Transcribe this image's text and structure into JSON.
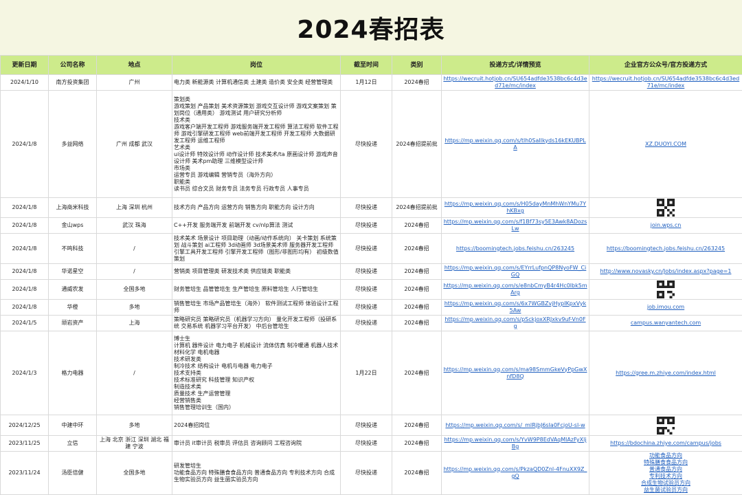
{
  "title": "2024春招表",
  "headers": [
    "更新日期",
    "公司名称",
    "地点",
    "岗位",
    "截至时间",
    "类别",
    "投递方式/详情预览",
    "企业官方公众号/官方投递方式"
  ],
  "rows": [
    {
      "date": "2024/1/10",
      "company": "南方投资集团",
      "location": "广州",
      "positions": "电力类 新能源类 计算机通信类 土建类 造价类 安全类 经营管理类",
      "deadline": "1月12日",
      "category": "2024春招",
      "apply": "https://wecruit.hotjob.cn/SU654adfde3538bc6c4d3ed71e/mc/index",
      "official": "https://wecruit.hotjob.cn/SU654adfde3538bc6c4d3ed71e/mc/index"
    },
    {
      "date": "2024/1/8",
      "company": "多益网络",
      "location": "广州 成都 武汉",
      "positions": "策划类\n游戏策划 产品策划 美术资源策划 游戏交互设计师 游戏文案策划 策划岗位（通用类） 游戏测试 用户研究分析师\n技术类\n游戏客户端开发工程师 游戏服务端开发工程师 算法工程师 软件工程师 游戏引擎研发工程师 web前端开发工程师 开发工程师 大数据研发工程师 运维工程师\n艺术类\nui设计师 特效设计师 动作设计师 技术美术/ta 原画设计师 游戏声音设计师 美术pm助理 三维模型设计师\n市场类\n运营专员 游戏编辑 营销专员（海外方向）\n职能类\n读书员 综合文员 财务专员 法务专员 行政专员 人事专员",
      "deadline": "尽快投递",
      "category": "2024春招提前批",
      "apply": "https://mp.weixin.qq.com/s/tlh0SaIlkyds16kEKUBPLA",
      "official": "XZ.DUOYI.COM"
    },
    {
      "date": "2024/1/8",
      "company": "上海商米科技",
      "location": "上海 深圳 杭州",
      "positions": "技术方向 产品方向 运营方向 销售方向 职能方向 设计方向",
      "deadline": "尽快投递",
      "category": "2024春招提前批",
      "apply": "https://mp.weixin.qq.com/s/H05dayMnMhWnYMu7YhKBxg",
      "official": ""
    },
    {
      "date": "2024/1/8",
      "company": "金山wps",
      "location": "武汉 珠海",
      "positions": "C++开发 服务端开发 前端开发 cv/nlp算法 测试",
      "deadline": "尽快投递",
      "category": "2024春招",
      "apply": "https://mp.weixin.qq.com/s/f1Bf73sy5E3Awk8ADozsLw",
      "official": "join.wps.cn"
    },
    {
      "date": "2024/1/8",
      "company": "不鸣科技",
      "location": "/",
      "positions": "技术美术 场景设计 项目助理（动画/动作系统向） 关卡策划 系统策划 战斗策划 ai工程师 3d动画师 3d场景美术师 服务器开发工程师 引擎工具开发工程师 引擎开发工程师（图形/非图形均有） 初级数值策划",
      "deadline": "尽快投递",
      "category": "2024春招",
      "apply": "https://boomingtech.jobs.feishu.cn/263245",
      "official": "https://boomingtech.jobs.feishu.cn/263245"
    },
    {
      "date": "2024/1/8",
      "company": "华诺星空",
      "location": "/",
      "positions": "营销类 项目管理类 研发技术类 供应链类 职能类",
      "deadline": "尽快投递",
      "category": "2024春招",
      "apply": "https://mp.weixin.qq.com/s/EYrrLufpnQP8NyoFW_CiGQ",
      "official": "http://www.novasky.cn/Jobs/index.aspx?page=1"
    },
    {
      "date": "2024/1/8",
      "company": "通威农发",
      "location": "全国多地",
      "positions": "财务管培生 品管管培生 生产管培生 原料管培生 人行管培生",
      "deadline": "尽快投递",
      "category": "2024春招",
      "apply": "https://mp.weixin.qq.com/s/e8nbCmyB4r4Hc0lbk5mArg",
      "official": ""
    },
    {
      "date": "2024/1/8",
      "company": "华橙",
      "location": "多地",
      "positions": "销售管培生 市场产品管培生（海外） 软件测试工程师 体验设计工程师",
      "deadline": "尽快投递",
      "category": "2024春招",
      "apply": "https://mp.weixin.qq.com/s/6x7WGBZvjHypIKpxVyk5Aw",
      "official": "job.imou.com"
    },
    {
      "date": "2024/1/5",
      "company": "顽岩资产",
      "location": "上海",
      "positions": "策略研究员 策略研究员（机器学习方向） 量化开发工程师（投研系统 交易系统 机器学习平台开发） 中后台管培生",
      "deadline": "尽快投递",
      "category": "2024春招",
      "apply": "https://mp.weixin.qq.com/s/pSckjoxXRJxkv9uf-Vn0Fg",
      "official": "campus.wanyantech.com"
    },
    {
      "date": "2024/1/3",
      "company": "格力电器",
      "location": "/",
      "positions": "博士生\n计算机 器件设计 电力电子 机械设计 流体仿真 制冷暖通 机器人技术 材料化学 电机电器\n技术研发类\n制冷技术 结构设计 电机与电器 电力电子\n技术支持类\n技术标准研究 科技管理 知识产权\n制造技术类\n质量技术 生产运营管理\n经营销售类\n销售管理培训生（国内）",
      "deadline": "1月22日",
      "category": "2024春招",
      "apply": "https://mp.weixin.qq.com/s/ma98SmmGkeVyPpGwXnfD8Q",
      "official": "https://gree.m.zhiye.com/index.html"
    },
    {
      "date": "2024/12/25",
      "company": "中建中环",
      "location": "多地",
      "positions": "2024春招岗位",
      "deadline": "尽快投递",
      "category": "2024春招",
      "apply": "https://mp.weixin.qq.com/s/_mlRjbJ6sIa0FcjoU-sl-w",
      "official": ""
    },
    {
      "date": "2023/11/25",
      "company": "立信",
      "location": "上海 北京 浙江 深圳 湖北 福建 宁波",
      "positions": "审计员 it审计员 税审员 评估员 咨询顾问 工程咨询院",
      "deadline": "尽快投递",
      "category": "2024春招",
      "apply": "https://mp.weixin.qq.com/s/YvW9P8EdVAqMlAzFyXljBg",
      "official": "https://bdochina.zhiye.com/campus/jobs"
    },
    {
      "date": "2023/11/24",
      "company": "汤臣倍健",
      "location": "全国多地",
      "positions": "研发管培生\n功能食品方向 特殊膳食食品方向 普通食品方向 专利技术方向 合成生物实验员方向 益生菌实验员方向",
      "deadline": "尽快投递",
      "category": "2024春招",
      "apply": "https://mp.weixin.qq.com/s/PkzaQD0Znl-4FnuXX9Z_gQ",
      "official": "功能食品方向\n特殊膳食食品方向\n普通食品方向\n专利技术方向\n合成生物试验员方向\n益生菌试验员方向"
    }
  ]
}
